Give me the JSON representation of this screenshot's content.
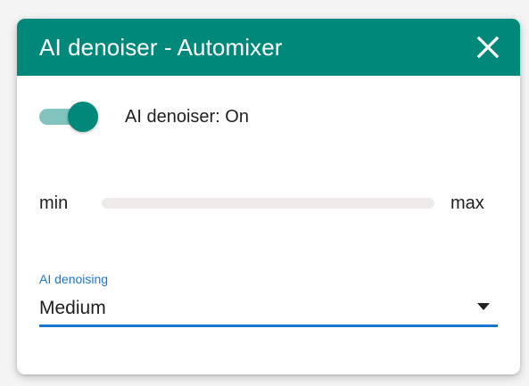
{
  "dialog": {
    "title": "AI denoiser - Automixer",
    "close_icon": "close-icon"
  },
  "toggle": {
    "label": "AI denoiser: On",
    "state": "on"
  },
  "slider": {
    "min_label": "min",
    "max_label": "max",
    "value_fraction": 0
  },
  "select": {
    "label": "AI denoising",
    "value": "Medium",
    "arrow_icon": "caret-down-icon"
  },
  "colors": {
    "header": "#00897b",
    "toggle_track": "#80c4bd",
    "accent_blue": "#1976d2"
  }
}
